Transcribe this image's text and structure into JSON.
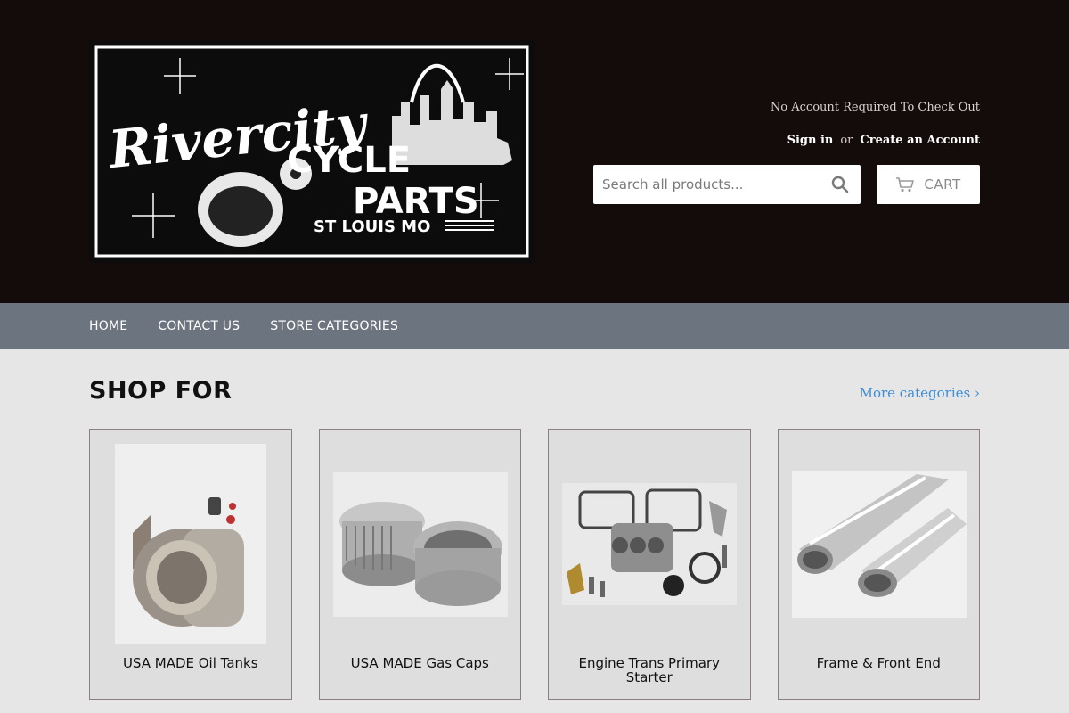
{
  "logo": {
    "alt": "Rivercity Cycle Parts St Louis MO",
    "text_line1": "Rivercity",
    "text_line2": "CYCLE",
    "text_line3": "PARTS",
    "text_line4": "ST LOUIS MO"
  },
  "account": {
    "note": "No Account Required To Check Out",
    "sign_in": "Sign in",
    "or": "or",
    "create": "Create an Account"
  },
  "search": {
    "placeholder": "Search all products..."
  },
  "cart": {
    "label": "CART"
  },
  "nav": {
    "items": [
      "HOME",
      "CONTACT US",
      "STORE CATEGORIES"
    ]
  },
  "shop": {
    "title": "SHOP FOR",
    "more_link": "More categories ›"
  },
  "categories": [
    {
      "title": "USA MADE Oil Tanks"
    },
    {
      "title": "USA MADE Gas Caps"
    },
    {
      "title": "Engine Trans Primary Starter"
    },
    {
      "title": "Frame & Front End"
    }
  ],
  "colors": {
    "header_bg": "#140b0b",
    "nav_bg": "#6c7480",
    "link": "#3d8ed8"
  }
}
